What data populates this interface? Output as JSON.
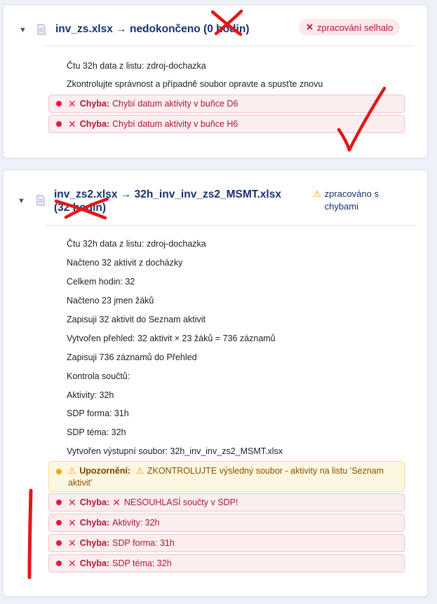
{
  "cards": [
    {
      "toggle_icon": "▼",
      "file_title": "inv_zs.xlsx → nedokončeno (0 hodin)",
      "status": {
        "icon": "✕",
        "text": "zpracování selhalo"
      },
      "logs": [
        "Čtu 32h data z listu: zdroj-dochazka",
        "Zkontrolujte správnost a případně soubor opravte a spusťte znovu"
      ],
      "errors": [
        {
          "label": "Chyba:",
          "text": "Chybí datum aktivity v buňce D6"
        },
        {
          "label": "Chyba:",
          "text": "Chybí datum aktivity v buňce H6"
        }
      ]
    },
    {
      "toggle_icon": "▼",
      "file_title": "inv_zs2.xlsx → 32h_inv_inv_zs2_MSMT.xlsx (32 hodin)",
      "status": {
        "icon": "⚠",
        "text": "zpracováno s chybami"
      },
      "logs": [
        "Čtu 32h data z listu: zdroj-dochazka",
        "Načteno 32 aktivit z docházky",
        "Celkem hodin: 32",
        "Načteno 23 jmen žáků",
        "Zapisuji 32 aktivit do Seznam aktivit",
        "Vytvořen přehled: 32 aktivit × 23 žáků = 736 záznamů",
        "Zapisuji 736 záznamů do Přehled",
        "Kontrola součtů:",
        "Aktivity: 32h",
        "SDP forma: 31h",
        "SDP téma: 32h",
        "Vytvořen výstupní soubor: 32h_inv_inv_zs2_MSMT.xlsx"
      ],
      "warning": {
        "label": "Upozornění:",
        "icon": "⚠",
        "text": "ZKONTROLUJTE výsledný soubor - aktivity na listu 'Seznam aktivit'"
      },
      "errors": [
        {
          "label": "Chyba:",
          "inner_icon": "✕",
          "text": "NESOUHLASÍ součty v SDP!"
        },
        {
          "label": "Chyba:",
          "text": "Aktivity: 32h"
        },
        {
          "label": "Chyba:",
          "text": "SDP forma: 31h"
        },
        {
          "label": "Chyba:",
          "text": "SDP téma: 32h"
        }
      ]
    }
  ],
  "icons": {
    "error": "✕",
    "file": "file-icon",
    "toggle": "chevron-down-icon"
  },
  "colors": {
    "title": "#16306f",
    "error": "#e0193d",
    "warning": "#f0a800",
    "annotation": "#e01818"
  }
}
